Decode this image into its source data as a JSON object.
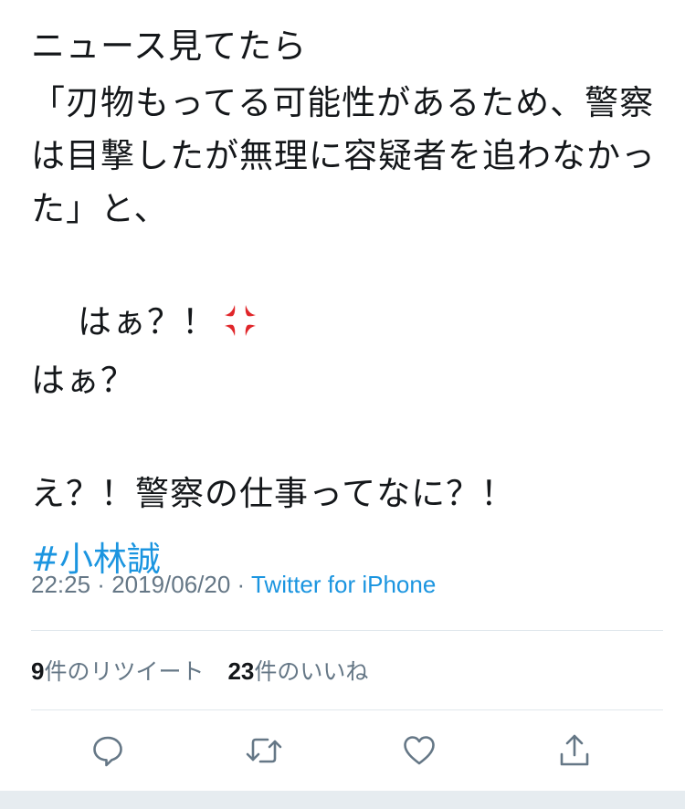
{
  "tweet": {
    "paragraph1": "ニュース見てたら",
    "paragraph2": "「刃物もってる可能性があるため、警察は目撃したが無理に容疑者を追わなかった」と、",
    "paragraph3_line1": "はぁ？！",
    "paragraph3_line2": "はぁ？",
    "paragraph4": "え？！警察の仕事ってなに？！",
    "hashtag": "#小林誠",
    "emoji": "anger-symbol"
  },
  "meta": {
    "time": "22:25",
    "separator1": " · ",
    "date": "2019/06/20",
    "separator2": " · ",
    "source": "Twitter for iPhone"
  },
  "stats": {
    "retweet_count": "9",
    "retweet_label": "件のリツイート",
    "like_count": "23",
    "like_label": "件のいいね"
  },
  "actions": {
    "reply_icon": "reply-icon",
    "retweet_icon": "retweet-icon",
    "like_icon": "heart-icon",
    "share_icon": "share-icon"
  },
  "colors": {
    "text": "#14171a",
    "link": "#1b95e0",
    "secondary": "#657786",
    "divider": "#e1e8ed",
    "anger": "#e0262a"
  }
}
